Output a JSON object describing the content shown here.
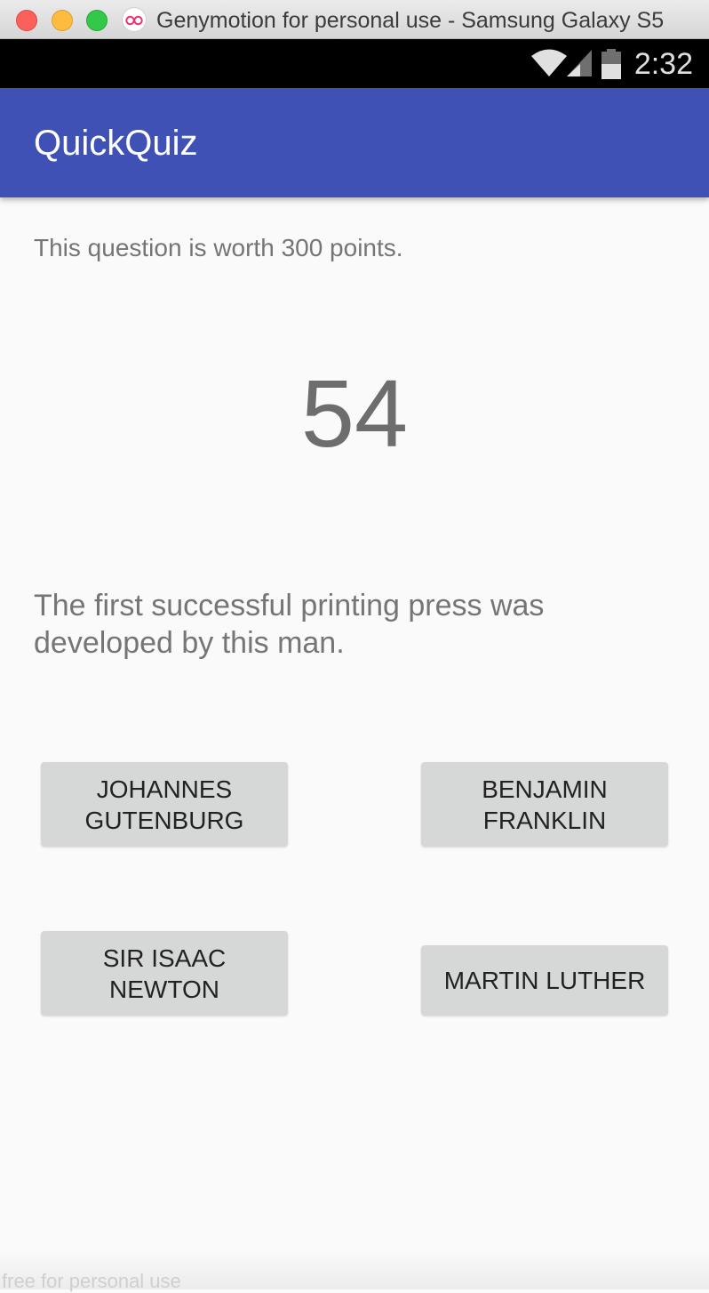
{
  "window": {
    "title": "Genymotion for personal use - Samsung Galaxy S5"
  },
  "statusbar": {
    "time": "2:32",
    "icons": [
      "wifi-icon",
      "signal-icon",
      "battery-icon"
    ]
  },
  "appbar": {
    "title": "QuickQuiz",
    "color": "#3f51b5"
  },
  "quiz": {
    "points_text": "This question is worth 300 points.",
    "countdown": "54",
    "question": "The first successful printing press was developed by this man.",
    "answers": [
      "JOHANNES GUTENBURG",
      "BENJAMIN FRANKLIN",
      "SIR ISAAC NEWTON",
      "MARTIN LUTHER"
    ]
  },
  "watermark": "free for personal use"
}
